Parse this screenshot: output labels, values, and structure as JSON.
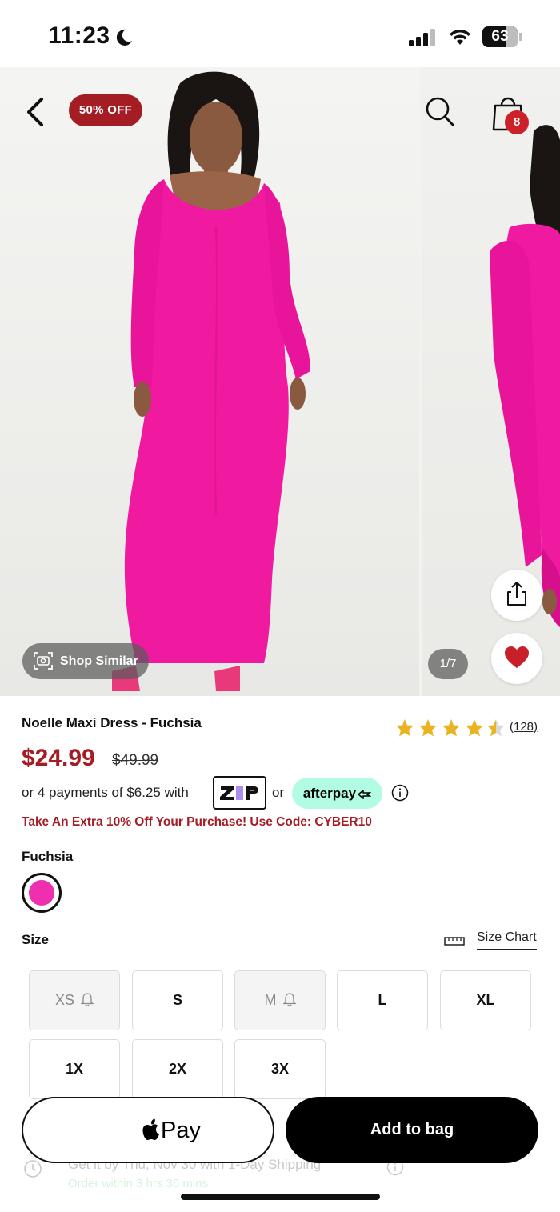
{
  "status_bar": {
    "time": "11:23",
    "battery": "63"
  },
  "header": {
    "sale_badge": "50% OFF",
    "bag_count": "8"
  },
  "gallery": {
    "shop_similar": "Shop Similar",
    "image_counter": "1/7"
  },
  "product": {
    "title": "Noelle Maxi Dress - Fuchsia",
    "rating": 4.5,
    "review_count": "(128)",
    "price_sale": "$24.99",
    "price_original": "$49.99",
    "installments_text": "or 4 payments of $6.25 with",
    "or_text": "or",
    "zip_label": "ZIP",
    "afterpay_label": "afterpay",
    "promo": "Take An Extra 10% Off Your Purchase! Use Code: CYBER10"
  },
  "color": {
    "label": "Fuchsia",
    "swatch_hex": "#ee30b0"
  },
  "size": {
    "label": "Size",
    "size_chart_label": "Size Chart",
    "options": [
      {
        "label": "XS",
        "available": false
      },
      {
        "label": "S",
        "available": true
      },
      {
        "label": "M",
        "available": false
      },
      {
        "label": "L",
        "available": true
      },
      {
        "label": "XL",
        "available": true
      },
      {
        "label": "1X",
        "available": true
      },
      {
        "label": "2X",
        "available": true
      },
      {
        "label": "3X",
        "available": true
      }
    ]
  },
  "actions": {
    "apple_pay_label": "Pay",
    "add_to_bag_label": "Add to bag"
  },
  "shipping": {
    "line1": "Get it by Thu, Nov 30 with 1-Day Shipping",
    "line2": "Order within 3 hrs 36 mins"
  },
  "colors": {
    "accent_red": "#a41c24",
    "product_pink": "#f01aa0",
    "afterpay_mint": "#b2fce4"
  }
}
